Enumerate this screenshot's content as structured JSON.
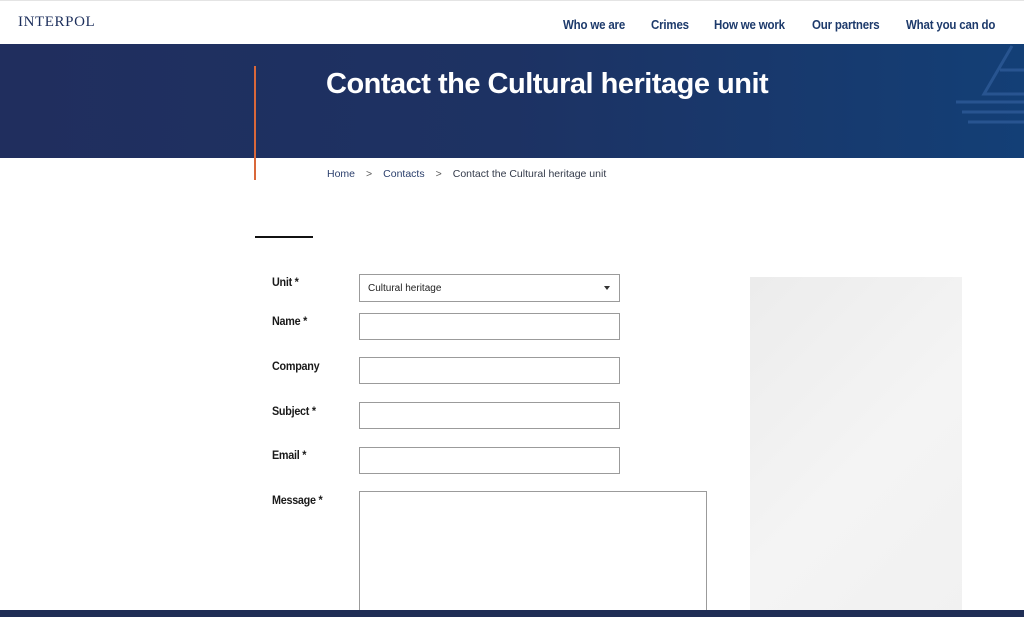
{
  "header": {
    "logo": "INTERPOL",
    "nav": [
      "Who we are",
      "Crimes",
      "How we work",
      "Our partners",
      "What you can do"
    ]
  },
  "hero": {
    "title": "Contact the Cultural heritage unit"
  },
  "breadcrumb": {
    "items": [
      "Home",
      "Contacts",
      "Contact the Cultural heritage unit"
    ],
    "separator": ">"
  },
  "form": {
    "unit_label": "Unit *",
    "unit_value": "Cultural heritage",
    "name_label": "Name *",
    "name_value": "",
    "company_label": "Company",
    "company_value": "",
    "subject_label": "Subject *",
    "subject_value": "",
    "email_label": "Email *",
    "email_value": "",
    "message_label": "Message *",
    "message_value": ""
  },
  "colors": {
    "navy": "#1d3263",
    "accent": "#d9683a",
    "nav_text": "#1d3a6b"
  },
  "icons": {
    "dropdown": "chevron-down-icon",
    "hero_decoration": "ship-outline-icon"
  }
}
